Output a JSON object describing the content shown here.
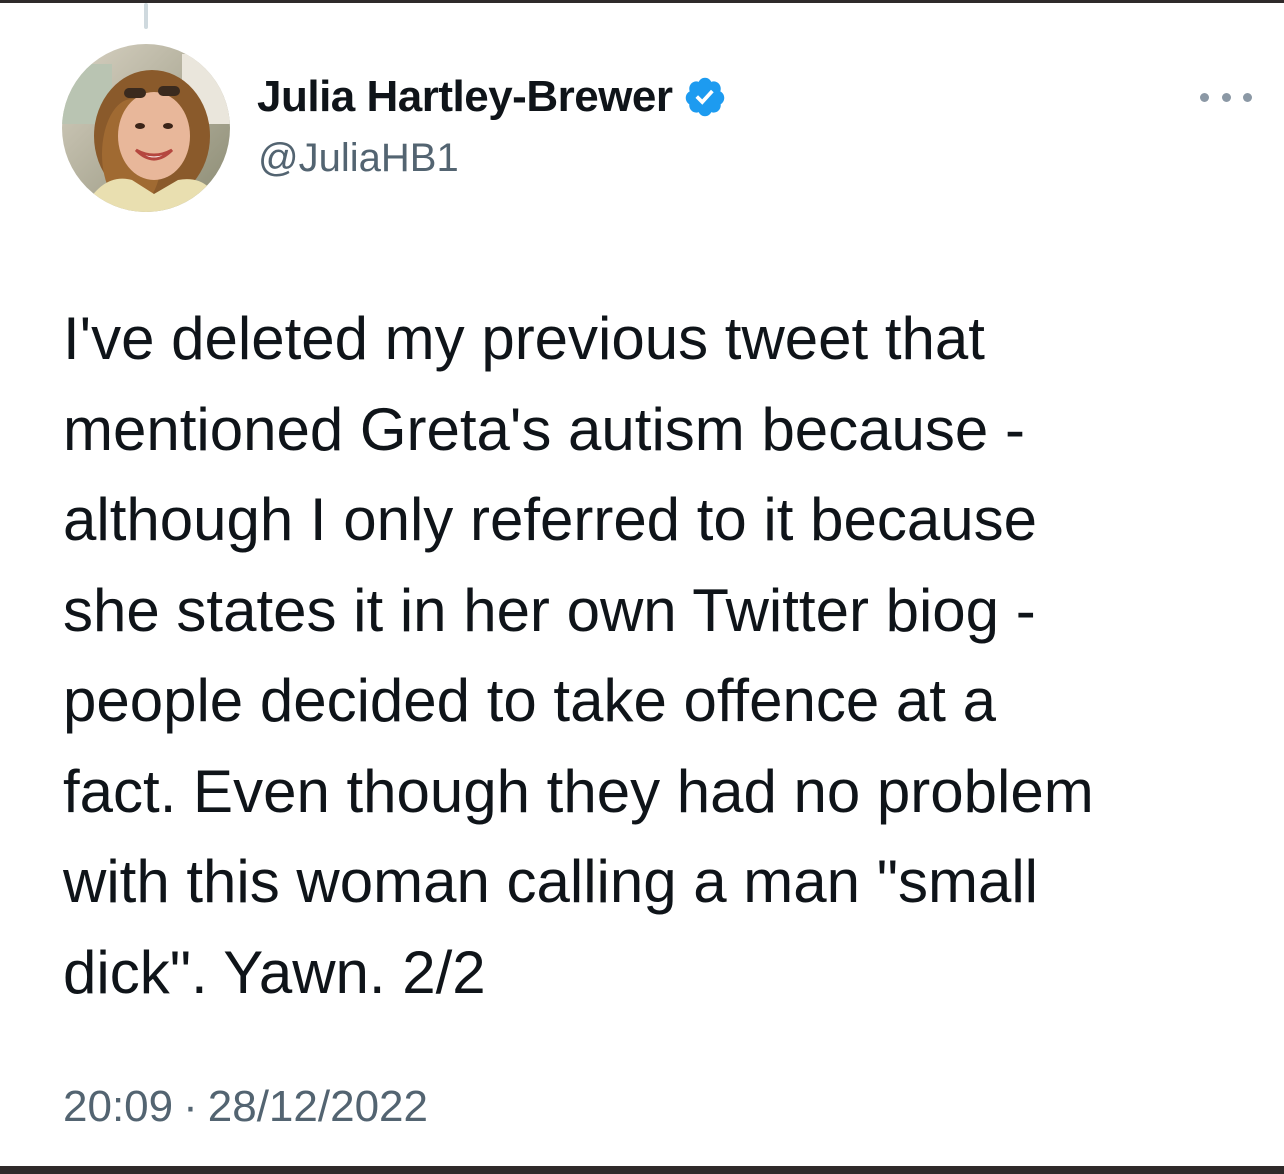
{
  "author": {
    "display_name": "Julia Hartley-Brewer",
    "handle": "@JuliaHB1",
    "verified": true
  },
  "tweet": {
    "lines": [
      "I've deleted my previous tweet that",
      "mentioned Greta's autism because -",
      "although I only referred to it because",
      "she states it in her own Twitter biog -",
      "people decided to take offence at a",
      "fact. Even though they had no problem",
      "with this woman calling a man \"small",
      "dick\". Yawn. 2/2"
    ]
  },
  "meta": {
    "time": "20:09",
    "separator": "·",
    "date": "28/12/2022"
  },
  "icons": {
    "verified": "verified-badge-icon",
    "more": "more-options-icon"
  },
  "colors": {
    "verified_blue": "#1d9bf0",
    "secondary_text": "#536471",
    "primary_text": "#0f1419"
  }
}
